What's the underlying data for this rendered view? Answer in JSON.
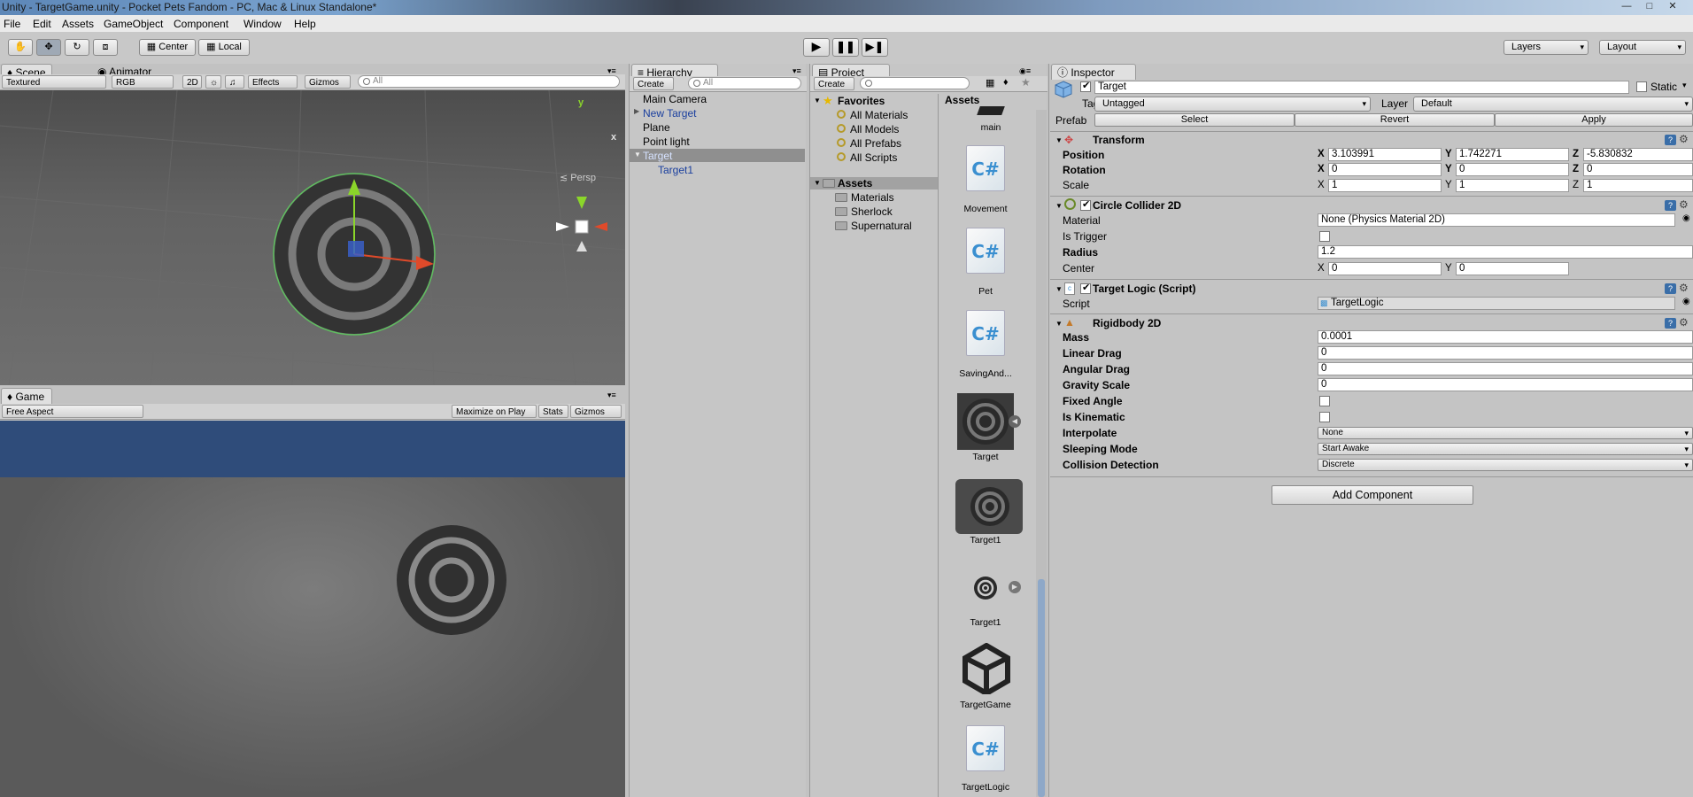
{
  "window": {
    "title": "Unity - TargetGame.unity - Pocket Pets Fandom - PC, Mac & Linux Standalone*"
  },
  "menu": [
    "File",
    "Edit",
    "Assets",
    "GameObject",
    "Component",
    "Window",
    "Help"
  ],
  "toolbar": {
    "center": "Center",
    "local": "Local",
    "layers": "Layers",
    "layout": "Layout"
  },
  "scene": {
    "tab": "Scene",
    "tab2": "Animator",
    "shading": "Textured",
    "rgb": "RGB",
    "mode2d": "2D",
    "effects": "Effects",
    "gizmos": "Gizmos",
    "search": "All",
    "persp": "Persp",
    "gizmo_y": "y",
    "gizmo_x": "x"
  },
  "game": {
    "tab": "Game",
    "aspect": "Free Aspect",
    "maximize": "Maximize on Play",
    "stats": "Stats",
    "gizmos": "Gizmos"
  },
  "hierarchy": {
    "tab": "Hierarchy",
    "create": "Create",
    "search": "All",
    "items": [
      "Main Camera",
      "New Target",
      "Plane",
      "Point light",
      "Target",
      "Target1"
    ]
  },
  "project": {
    "tab": "Project",
    "create": "Create",
    "favorites_header": "Favorites",
    "favorites": [
      "All Materials",
      "All Models",
      "All Prefabs",
      "All Scripts"
    ],
    "assets_header": "Assets",
    "folders": [
      "Materials",
      "Sherlock",
      "Supernatural"
    ],
    "breadcrumb": "Assets",
    "assets": [
      "main",
      "Movement",
      "Pet",
      "SavingAnd...",
      "Target",
      "Target1",
      "Target1",
      "TargetGame",
      "TargetLogic"
    ]
  },
  "inspector": {
    "tab": "Inspector",
    "name": "Target",
    "static": "Static",
    "tag_label": "Tag",
    "tag": "Untagged",
    "layer_label": "Layer",
    "layer": "Default",
    "prefab_label": "Prefab",
    "select": "Select",
    "revert": "Revert",
    "apply": "Apply",
    "transform": {
      "title": "Transform",
      "position": "Position",
      "rotation": "Rotation",
      "scale": "Scale",
      "pos": [
        "3.103991",
        "1.742271",
        "-5.830832"
      ],
      "rot": [
        "0",
        "0",
        "0"
      ],
      "scl": [
        "1",
        "1",
        "1"
      ]
    },
    "collider": {
      "title": "Circle Collider 2D",
      "material_label": "Material",
      "material": "None (Physics Material 2D)",
      "trigger_label": "Is Trigger",
      "radius_label": "Radius",
      "radius": "1.2",
      "center_label": "Center",
      "cx": "0",
      "cy": "0"
    },
    "logic": {
      "title": "Target Logic (Script)",
      "script_label": "Script",
      "script": "TargetLogic"
    },
    "rigidbody": {
      "title": "Rigidbody 2D",
      "mass_label": "Mass",
      "mass": "0.0001",
      "ldrag_label": "Linear Drag",
      "ldrag": "0",
      "adrag_label": "Angular Drag",
      "adrag": "0",
      "grav_label": "Gravity Scale",
      "grav": "0",
      "fixed_label": "Fixed Angle",
      "kin_label": "Is Kinematic",
      "interp_label": "Interpolate",
      "interp": "None",
      "sleep_label": "Sleeping Mode",
      "sleep": "Start Awake",
      "coll_label": "Collision Detection",
      "coll": "Discrete"
    },
    "add_component": "Add Component",
    "axes": [
      "X",
      "Y",
      "Z"
    ]
  }
}
